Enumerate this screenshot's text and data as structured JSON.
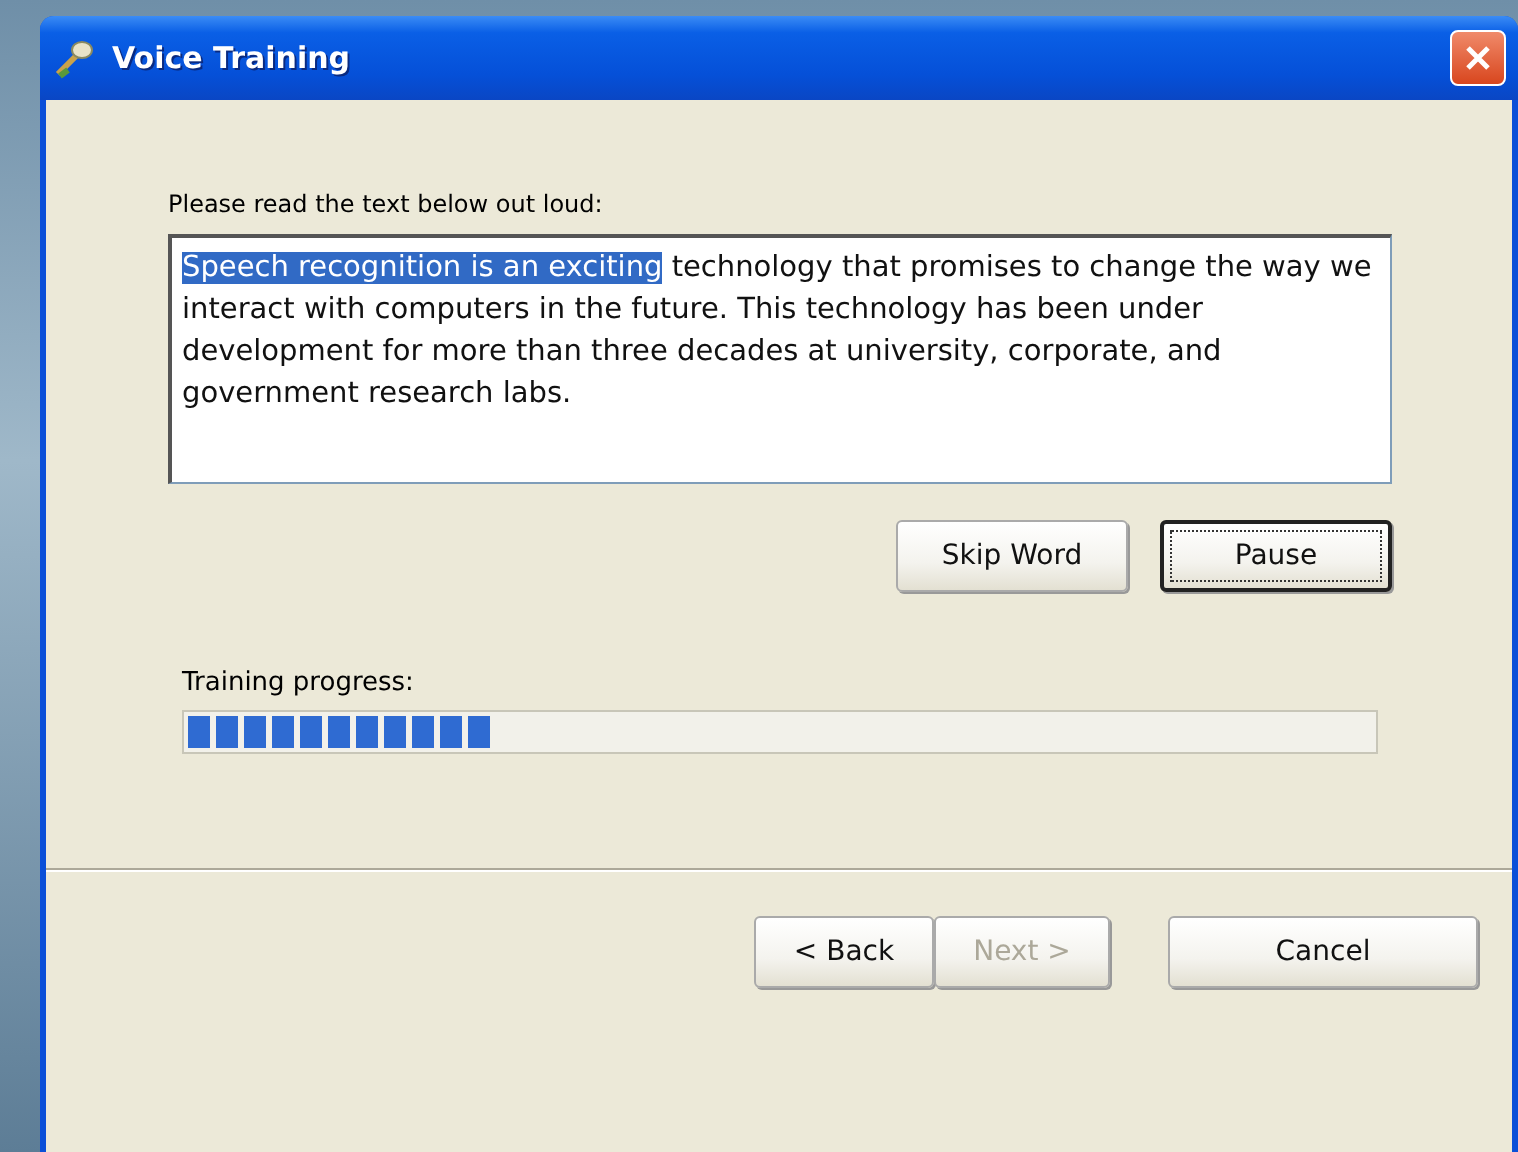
{
  "window": {
    "title": "Voice Training"
  },
  "instruction": "Please read the text below out loud:",
  "passage": {
    "highlighted": "Speech recognition is an exciting",
    "rest": "technology that promises to change the way we interact with computers in the future.  This technology has been under development for more than three decades at university, corporate, and government research labs."
  },
  "reading_buttons": [
    {
      "label": "Skip Word",
      "focused": false
    },
    {
      "label": "Pause",
      "focused": true
    }
  ],
  "progress": {
    "label": "Training progress:",
    "level": 0.26
  },
  "buttons": [
    {
      "label": "< Back",
      "disabled": false
    },
    {
      "label": "Next >",
      "disabled": true
    },
    {
      "label": "Cancel",
      "disabled": false
    }
  ]
}
